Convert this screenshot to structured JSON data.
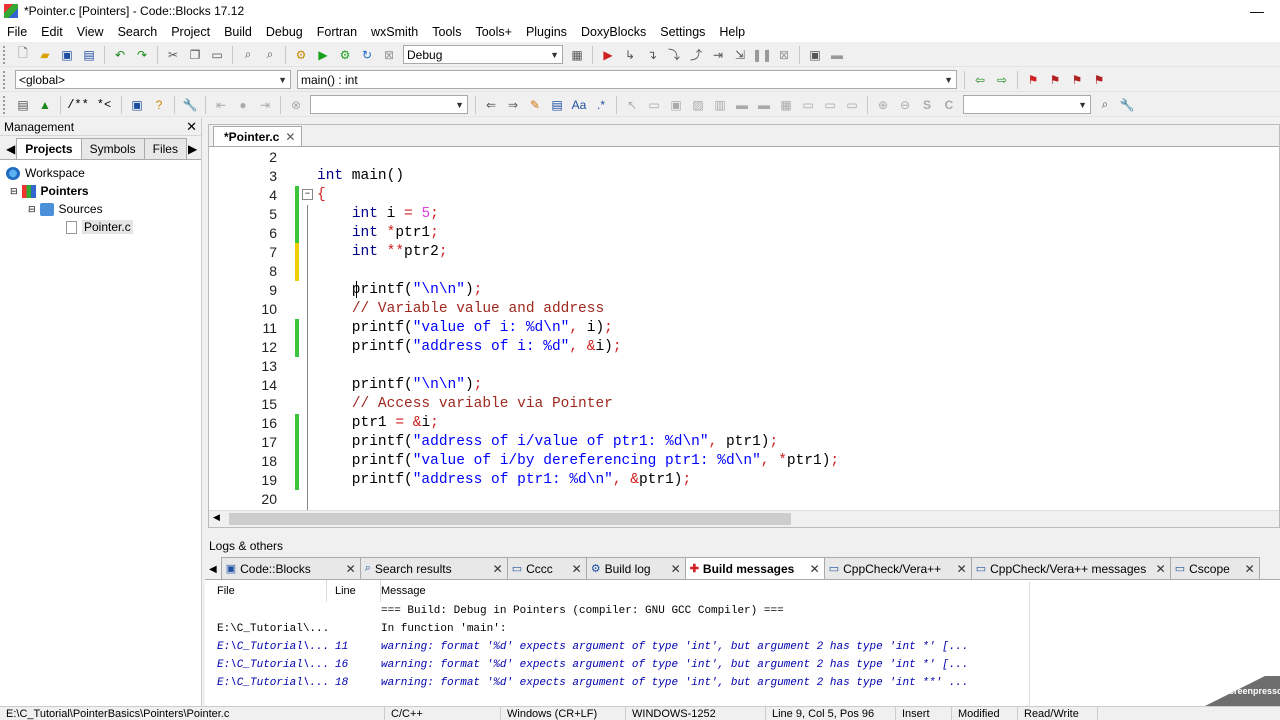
{
  "window": {
    "title": "*Pointer.c [Pointers] - Code::Blocks 17.12",
    "minimize": "—",
    "close": "✕"
  },
  "menu": [
    "File",
    "Edit",
    "View",
    "Search",
    "Project",
    "Build",
    "Debug",
    "Fortran",
    "wxSmith",
    "Tools",
    "Tools+",
    "Plugins",
    "DoxyBlocks",
    "Settings",
    "Help"
  ],
  "toolbar": {
    "build_target": "Debug"
  },
  "scope": {
    "scope_value": "<global>",
    "function_value": "main() : int"
  },
  "toolbar3": {
    "comment_block": "/**",
    "comment_line": "*<"
  },
  "management": {
    "title": "Management",
    "close": "✕",
    "tabs": [
      "Projects",
      "Symbols",
      "Files"
    ],
    "tree": {
      "workspace": "Workspace",
      "project": "Pointers",
      "folder": "Sources",
      "file": "Pointer.c"
    }
  },
  "editor": {
    "tab_label": "*Pointer.c",
    "tab_close": "✕",
    "lines": [
      {
        "n": "2",
        "marker": "",
        "code": ""
      },
      {
        "n": "3",
        "marker": "",
        "code": "int main()"
      },
      {
        "n": "4",
        "marker": "green",
        "code": "{"
      },
      {
        "n": "5",
        "marker": "green",
        "code": "    int i = 5;"
      },
      {
        "n": "6",
        "marker": "green",
        "code": "    int *ptr1;"
      },
      {
        "n": "7",
        "marker": "yellow",
        "code": "    int **ptr2;"
      },
      {
        "n": "8",
        "marker": "yellow",
        "code": ""
      },
      {
        "n": "9",
        "marker": "",
        "code": "    printf(\"\\n\\n\");"
      },
      {
        "n": "10",
        "marker": "",
        "code": "    // Variable value and address"
      },
      {
        "n": "11",
        "marker": "green",
        "code": "    printf(\"value of i: %d\\n\", i);"
      },
      {
        "n": "12",
        "marker": "green",
        "code": "    printf(\"address of i: %d\", &i);"
      },
      {
        "n": "13",
        "marker": "",
        "code": ""
      },
      {
        "n": "14",
        "marker": "",
        "code": "    printf(\"\\n\\n\");"
      },
      {
        "n": "15",
        "marker": "",
        "code": "    // Access variable via Pointer"
      },
      {
        "n": "16",
        "marker": "green",
        "code": "    ptr1 = &i;"
      },
      {
        "n": "17",
        "marker": "green",
        "code": "    printf(\"address of i/value of ptr1: %d\\n\", ptr1);"
      },
      {
        "n": "18",
        "marker": "green",
        "code": "    printf(\"value of i/by dereferencing ptr1: %d\\n\", *ptr1);"
      },
      {
        "n": "19",
        "marker": "green",
        "code": "    printf(\"address of ptr1: %d\\n\", &ptr1);"
      },
      {
        "n": "20",
        "marker": "",
        "code": ""
      }
    ]
  },
  "logs": {
    "title": "Logs & others",
    "tabs": [
      {
        "label": "Code::Blocks",
        "active": false
      },
      {
        "label": "Search results",
        "active": false
      },
      {
        "label": "Cccc",
        "active": false
      },
      {
        "label": "Build log",
        "active": false
      },
      {
        "label": "Build messages",
        "active": true
      },
      {
        "label": "CppCheck/Vera++",
        "active": false
      },
      {
        "label": "CppCheck/Vera++ messages",
        "active": false
      },
      {
        "label": "Cscope",
        "active": false
      }
    ],
    "tab_close": "✕",
    "columns": [
      "File",
      "Line",
      "Message"
    ],
    "rows": [
      {
        "file": "",
        "line": "",
        "message": "=== Build: Debug in Pointers (compiler: GNU GCC Compiler) ===",
        "warn": false
      },
      {
        "file": "E:\\C_Tutorial\\...",
        "line": "",
        "message": "In function 'main':",
        "warn": false
      },
      {
        "file": "E:\\C_Tutorial\\...",
        "line": "11",
        "message": "warning: format '%d' expects argument of type 'int', but argument 2 has type 'int *' [...",
        "warn": true
      },
      {
        "file": "E:\\C_Tutorial\\...",
        "line": "16",
        "message": "warning: format '%d' expects argument of type 'int', but argument 2 has type 'int *' [...",
        "warn": true
      },
      {
        "file": "E:\\C_Tutorial\\...",
        "line": "18",
        "message": "warning: format '%d' expects argument of type 'int', but argument 2 has type 'int **' ...",
        "warn": true
      }
    ]
  },
  "status": [
    "E:\\C_Tutorial\\PointerBasics\\Pointers\\Pointer.c",
    "C/C++",
    "Windows (CR+LF)",
    "WINDOWS-1252",
    "Line 9, Col 5, Pos 96",
    "Insert",
    "Modified",
    "Read/Write"
  ],
  "watermark": "Screenpresso"
}
